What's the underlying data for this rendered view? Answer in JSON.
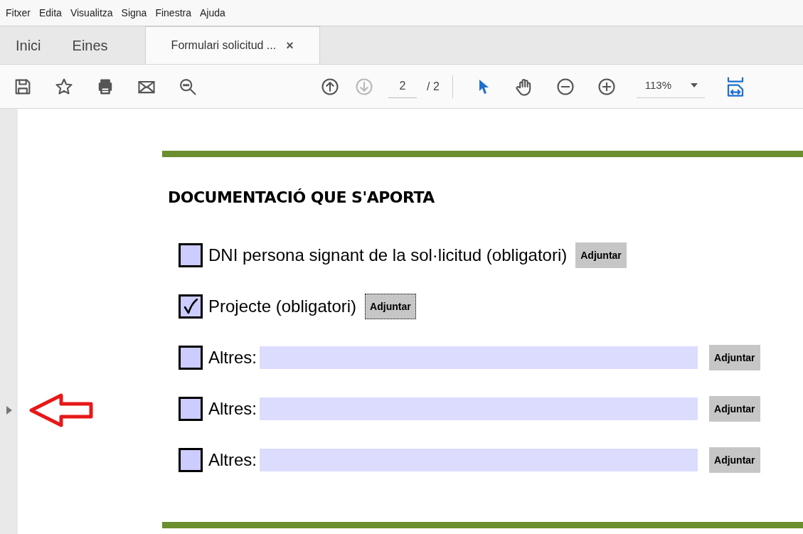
{
  "menu": [
    "Fitxer",
    "Edita",
    "Visualitza",
    "Signa",
    "Finestra",
    "Ajuda"
  ],
  "tabs": [
    {
      "label": "Inici",
      "selected": false
    },
    {
      "label": "Eines",
      "selected": false
    },
    {
      "label": "Formulari solicitud ...",
      "selected": true,
      "close": "×"
    }
  ],
  "toolbar": {
    "page": "2",
    "page_total": "/ 2",
    "zoom": "113%"
  },
  "form": {
    "heading": "DOCUMENTACIÓ QUE S'APORTA",
    "items": [
      {
        "kind": "attachment",
        "label": "DNI persona signant de la sol·licitud (obligatori)",
        "checked": false,
        "button": "Adjuntar",
        "focused": false
      },
      {
        "kind": "attachment",
        "label": "Projecte (obligatori)",
        "checked": true,
        "button": "Adjuntar",
        "focused": true
      },
      {
        "kind": "other",
        "label": "Altres:",
        "checked": false,
        "button": "Adjuntar",
        "focused": false
      },
      {
        "kind": "other",
        "label": "Altres:",
        "checked": false,
        "button": "Adjuntar",
        "focused": false
      },
      {
        "kind": "other",
        "label": "Altres:",
        "checked": false,
        "button": "Adjuntar",
        "focused": false
      }
    ]
  }
}
